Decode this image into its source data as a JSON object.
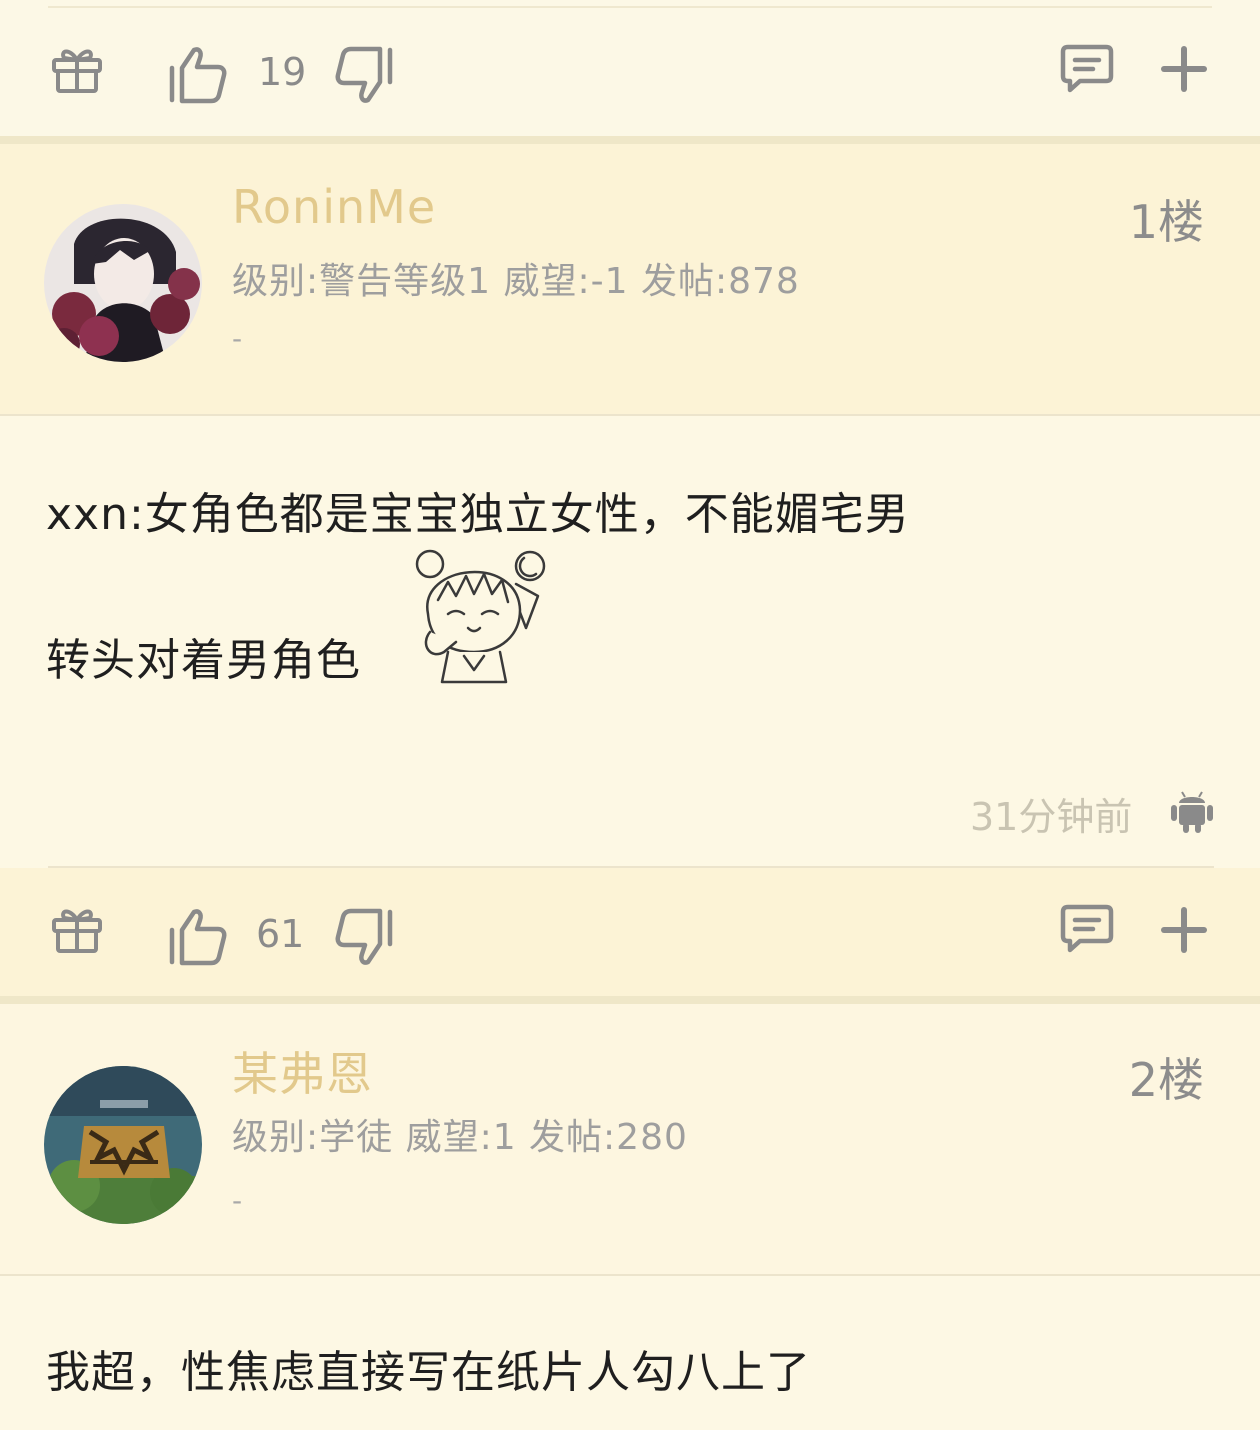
{
  "prev_post_actions": {
    "like_count": "19"
  },
  "posts": [
    {
      "username": "RoninMe",
      "meta": "级别:警告等级1 威望:-1 发帖:878",
      "signature": "-",
      "floor": "1楼",
      "content_line1": "xxn:女角色都是宝宝独立女性，不能媚宅男",
      "content_line2": "转头对着男角色",
      "timestamp": "31分钟前",
      "like_count": "61"
    },
    {
      "username": "某弗恩",
      "meta": "级别:学徒 威望:1 发帖:280",
      "signature": "-",
      "floor": "2楼",
      "content_line1": "我超，性焦虑直接写在纸片人勾八上了"
    }
  ],
  "colors": {
    "background": "#fdf8e4",
    "header_background": "#fcf3d6",
    "username": "#e2c98c",
    "icon": "#8a8a8a"
  },
  "icons": [
    "gift-icon",
    "thumbs-up-icon",
    "thumbs-down-icon",
    "comment-icon",
    "plus-icon",
    "android-icon",
    "emoticon-sticker"
  ]
}
